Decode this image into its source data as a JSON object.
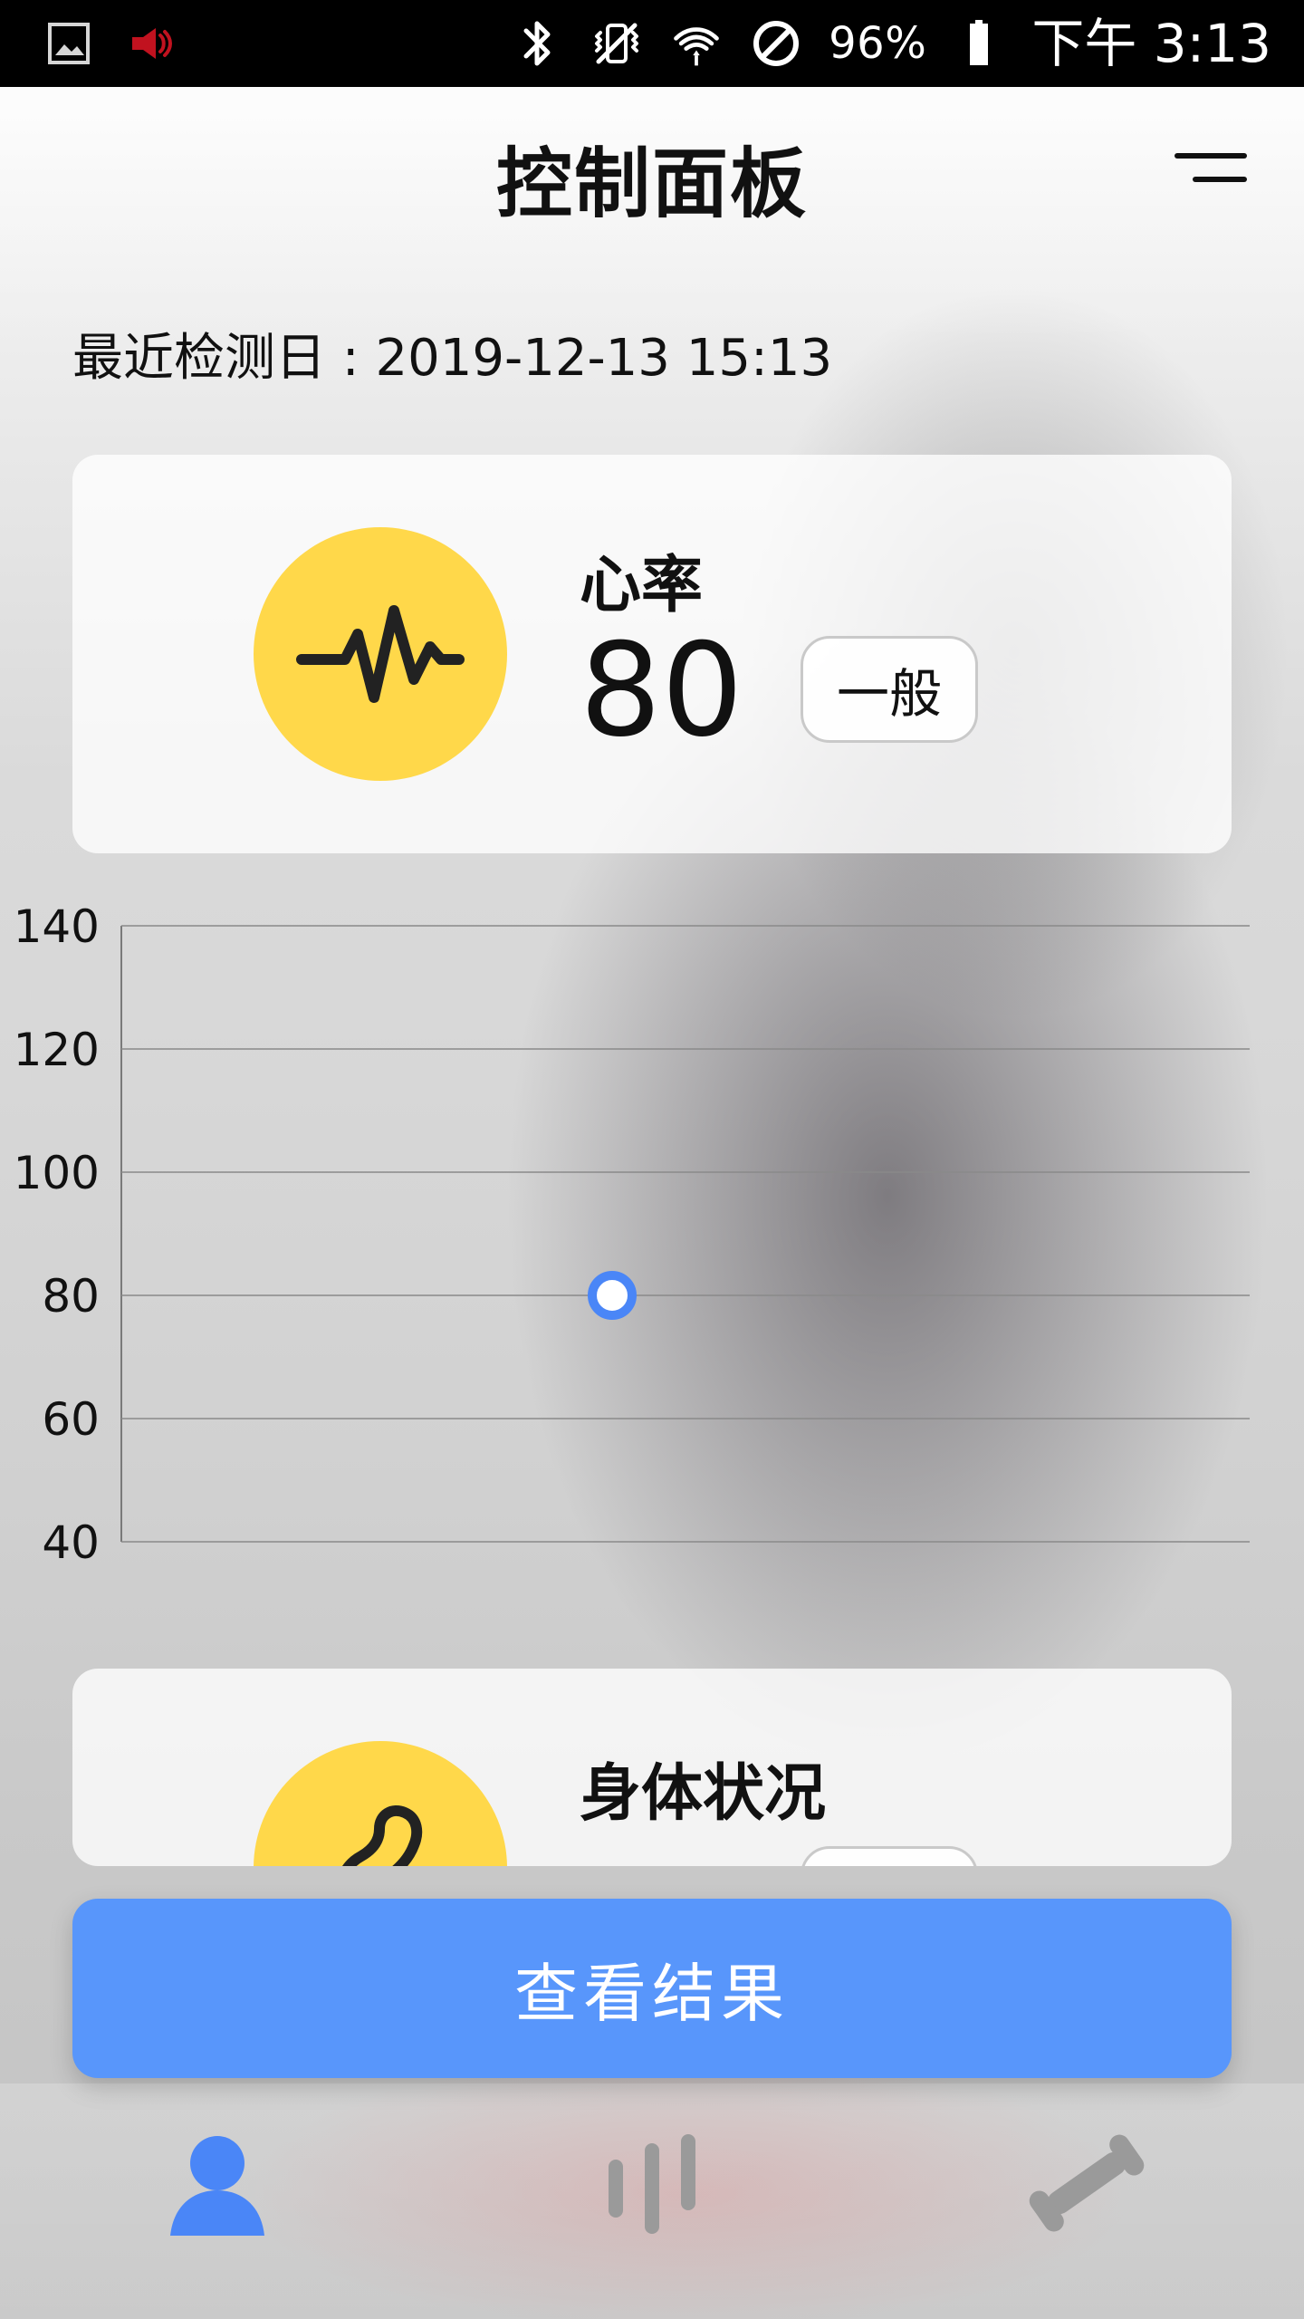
{
  "status_bar": {
    "battery": "96%",
    "time": "下午 3:13",
    "icons": [
      "gallery-icon",
      "volume-icon",
      "bluetooth-icon",
      "vibrate-icon",
      "wifi-icon",
      "do-not-disturb-icon",
      "battery-icon"
    ]
  },
  "header": {
    "title": "控制面板",
    "menu_icon": "menu-icon"
  },
  "last_check": {
    "label": "最近检测日",
    "separator": " : ",
    "value": "2019-12-13 15:13"
  },
  "cards": [
    {
      "icon": "heartbeat-icon",
      "title": "心率",
      "value": "80",
      "status": "一般"
    },
    {
      "icon": "muscle-icon",
      "title": "身体状况",
      "value": "",
      "status": ""
    }
  ],
  "chart_data": {
    "type": "scatter",
    "title": "",
    "xlabel": "",
    "ylabel": "",
    "ylim": [
      40,
      140
    ],
    "yticks": [
      140,
      120,
      100,
      80,
      60,
      40
    ],
    "series": [
      {
        "points": [
          {
            "y": 80
          }
        ]
      }
    ],
    "grid": true,
    "color": "#4a86f7"
  },
  "actions": {
    "view_results": "查看结果"
  },
  "bottom_nav": [
    {
      "icon": "user-icon",
      "active": true
    },
    {
      "icon": "stats-icon",
      "active": false
    },
    {
      "icon": "dumbbell-icon",
      "active": false
    }
  ],
  "colors": {
    "accent": "#5896fb",
    "yellow": "#ffd84a",
    "nav_inactive": "#9a9a9a",
    "nav_active": "#4a86f7"
  }
}
